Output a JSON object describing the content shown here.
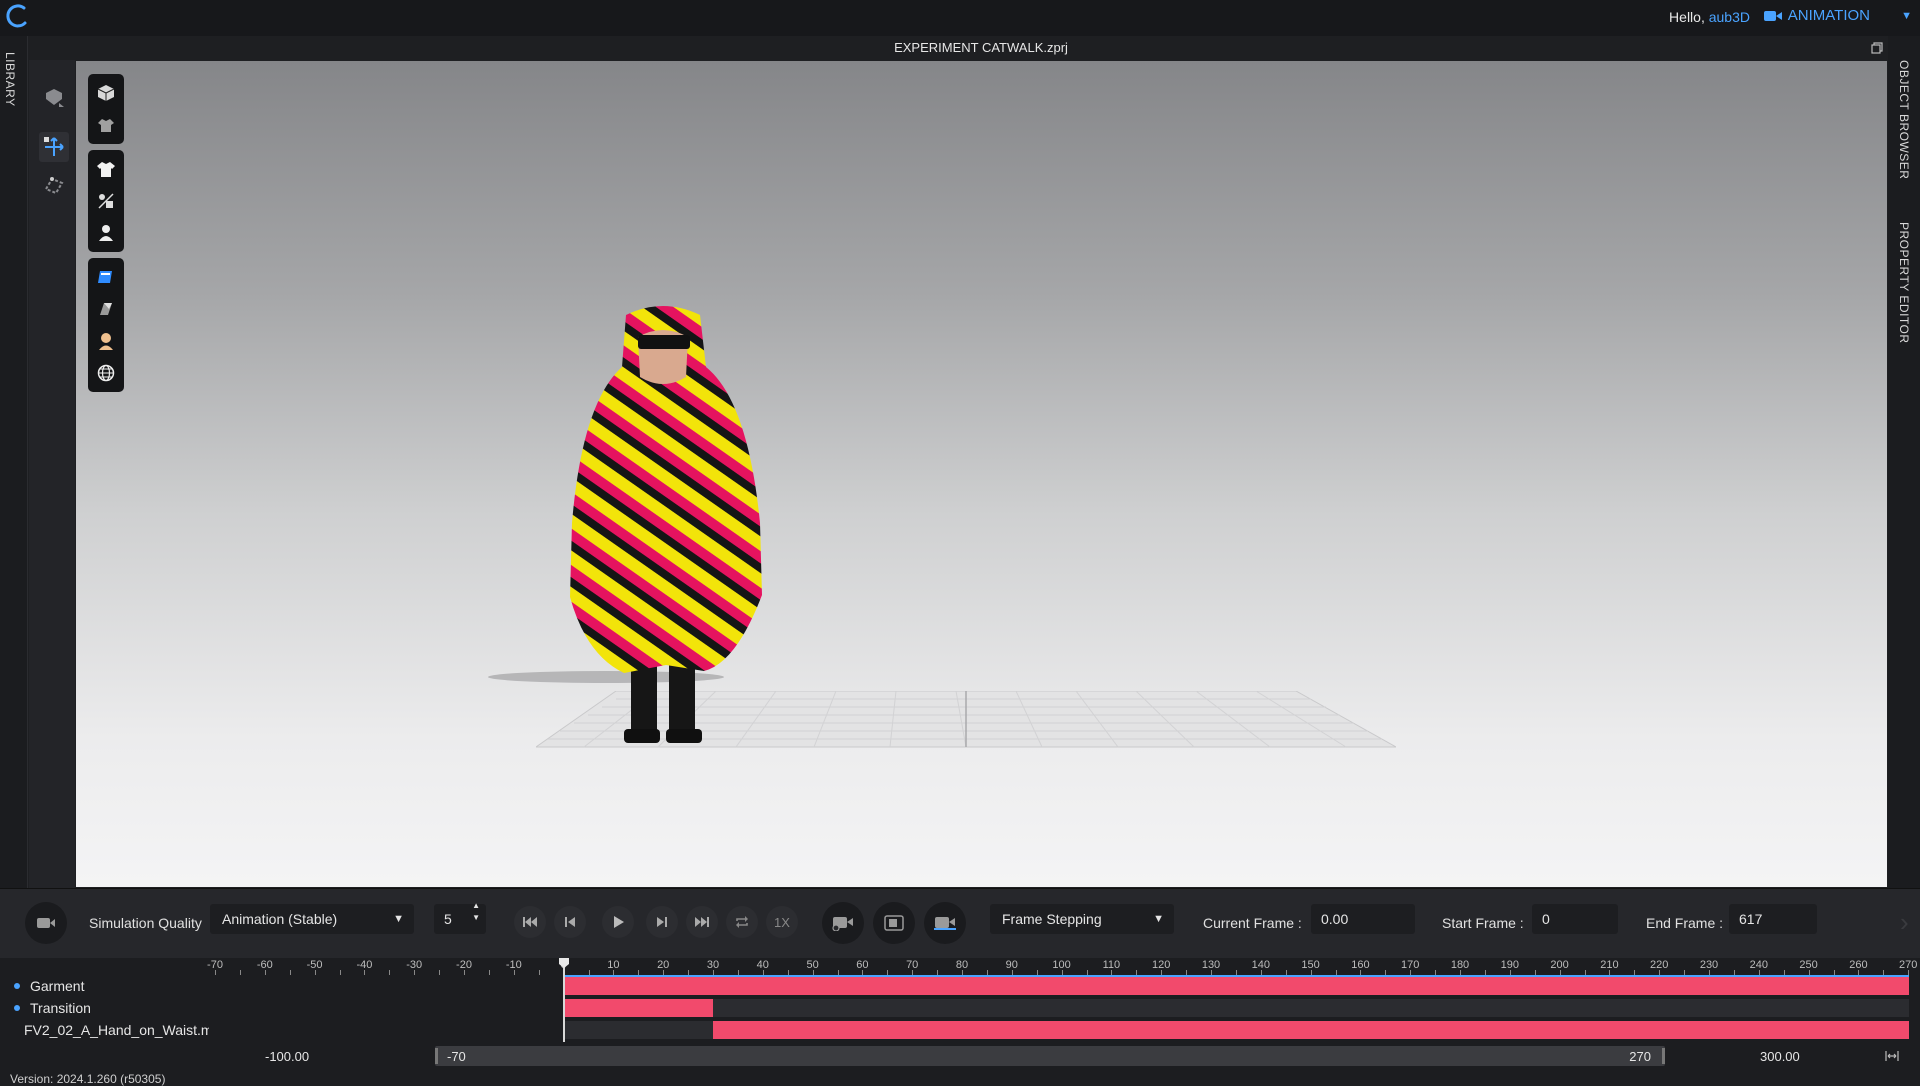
{
  "app": {
    "greeting": "Hello,",
    "username": "aub3D",
    "mode": "ANIMATION",
    "file_title": "EXPERIMENT CATWALK.zprj",
    "version": "Version: 2024.1.260 (r50305)"
  },
  "side_tabs": {
    "left": "LIBRARY",
    "right_top": "OBJECT BROWSER",
    "right_bottom": "PROPERTY EDITOR"
  },
  "animbar": {
    "sim_quality_label": "Simulation Quality",
    "sim_quality_value": "Animation (Stable)",
    "steps_value": "5",
    "speed_label": "1X",
    "frame_mode": "Frame Stepping",
    "current_frame_label": "Current Frame :",
    "current_frame_value": "0.00",
    "start_frame_label": "Start Frame :",
    "start_frame_value": "0",
    "end_frame_label": "End Frame :",
    "end_frame_value": "617"
  },
  "timeline": {
    "ruler_labels": [
      "-70",
      "-60",
      "-50",
      "-40",
      "-30",
      "-20",
      "-10",
      "0",
      "10",
      "20",
      "30",
      "40",
      "50",
      "60",
      "70",
      "80",
      "90",
      "100",
      "110",
      "120",
      "130",
      "140",
      "150",
      "160",
      "170",
      "180",
      "190",
      "200",
      "210",
      "220",
      "230",
      "240",
      "250",
      "260",
      "270"
    ],
    "tracks": [
      {
        "label": "Garment"
      },
      {
        "label": "Transition"
      },
      {
        "label": "FV2_02_A_Hand_on_Waist.m"
      }
    ],
    "range_min": "-100.00",
    "range_start": "-70",
    "range_end": "270",
    "range_max": "300.00"
  },
  "colors": {
    "accent": "#4aa3ff",
    "track": "#f24a6c"
  }
}
